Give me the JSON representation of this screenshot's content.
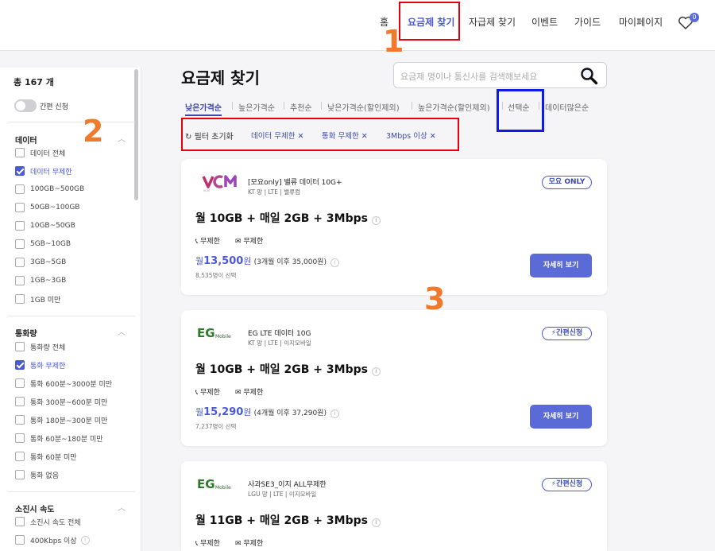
{
  "nav": {
    "items": [
      "홈",
      "요금제 찾기",
      "자급제 찾기",
      "이벤트",
      "가이드",
      "마이페이지"
    ],
    "active_index": 1,
    "wishlist_count": "0"
  },
  "sidebar": {
    "total": "총 167 개",
    "easy_toggle": "간편 신청",
    "sections": [
      {
        "title": "데이터",
        "options": [
          "데이터 전체",
          "데이터 무제한",
          "100GB~500GB",
          "50GB~100GB",
          "10GB~50GB",
          "5GB~10GB",
          "3GB~5GB",
          "1GB~3GB",
          "1GB 미만"
        ],
        "checked": 1
      },
      {
        "title": "통화량",
        "options": [
          "통화량 전체",
          "통화 무제한",
          "통화 600분~3000분 미만",
          "통화 300분~600분 미만",
          "통화 180분~300분 미만",
          "통화 60분~180분 미만",
          "통화 60분 미만",
          "통화 없음"
        ],
        "checked": 1
      },
      {
        "title": "소진시 속도",
        "options": [
          "소진시 속도 전체",
          "400Kbps 이상"
        ],
        "checked": -1
      }
    ]
  },
  "main": {
    "title": "요금제 찾기",
    "search_placeholder": "요금제 명이나 통신사를 검색해보세요",
    "sort_tabs": [
      "낮은가격순",
      "높은가격순",
      "추천순",
      "낮은가격순(할인제외)",
      "높은가격순(할인제외)",
      "선택순",
      "데이터많은순"
    ],
    "active_sort": 0,
    "filter_reset": "필터 초기화",
    "filter_chips": [
      "데이터 무제한",
      "통화 무제한",
      "3Mbps 이상"
    ]
  },
  "annotations": {
    "one": "1",
    "two": "2",
    "three": "3"
  },
  "colors": {
    "accent": "#4a5ad6",
    "annotation_red": "#e8000f",
    "annotation_blue": "#0d1be6",
    "annotation_number": "#f07a2c"
  },
  "plans": [
    {
      "brand_logo": "VCM",
      "name": "[모요only] 밸류 데이터 10G+",
      "sub": "KT 망 | LTE | 밸류컴",
      "tag": "모요 ONLY",
      "headline": "월 10GB + 매일 2GB + 3Mbps",
      "call": "무제한",
      "sms": "무제한",
      "price_prefix": "월",
      "price": "13,500",
      "price_unit": "원",
      "price_after": "(3개월 이후 35,000원)",
      "selected": "8,535명이 선택",
      "button": "자세히 보기"
    },
    {
      "brand_logo": "EG",
      "brand_logo_small": "Mobile",
      "name": "EG LTE 데이터 10G",
      "sub": "KT 망 | LTE | 이지모바일",
      "tag": "⚡간편신청",
      "headline": "월 10GB + 매일 2GB + 3Mbps",
      "call": "무제한",
      "sms": "무제한",
      "price_prefix": "월",
      "price": "15,290",
      "price_unit": "원",
      "price_after": "(4개월 이후 37,290원)",
      "selected": "7,237명이 선택",
      "button": "자세히 보기"
    },
    {
      "brand_logo": "EG",
      "brand_logo_small": "Mobile",
      "name": "사과SE3_이지 ALL무제한",
      "sub": "LGU 망 | LTE | 이지모바일",
      "tag": "⚡간편신청",
      "headline": "월 11GB + 매일 2GB + 3Mbps",
      "call": "무제한",
      "sms": "무제한"
    }
  ]
}
